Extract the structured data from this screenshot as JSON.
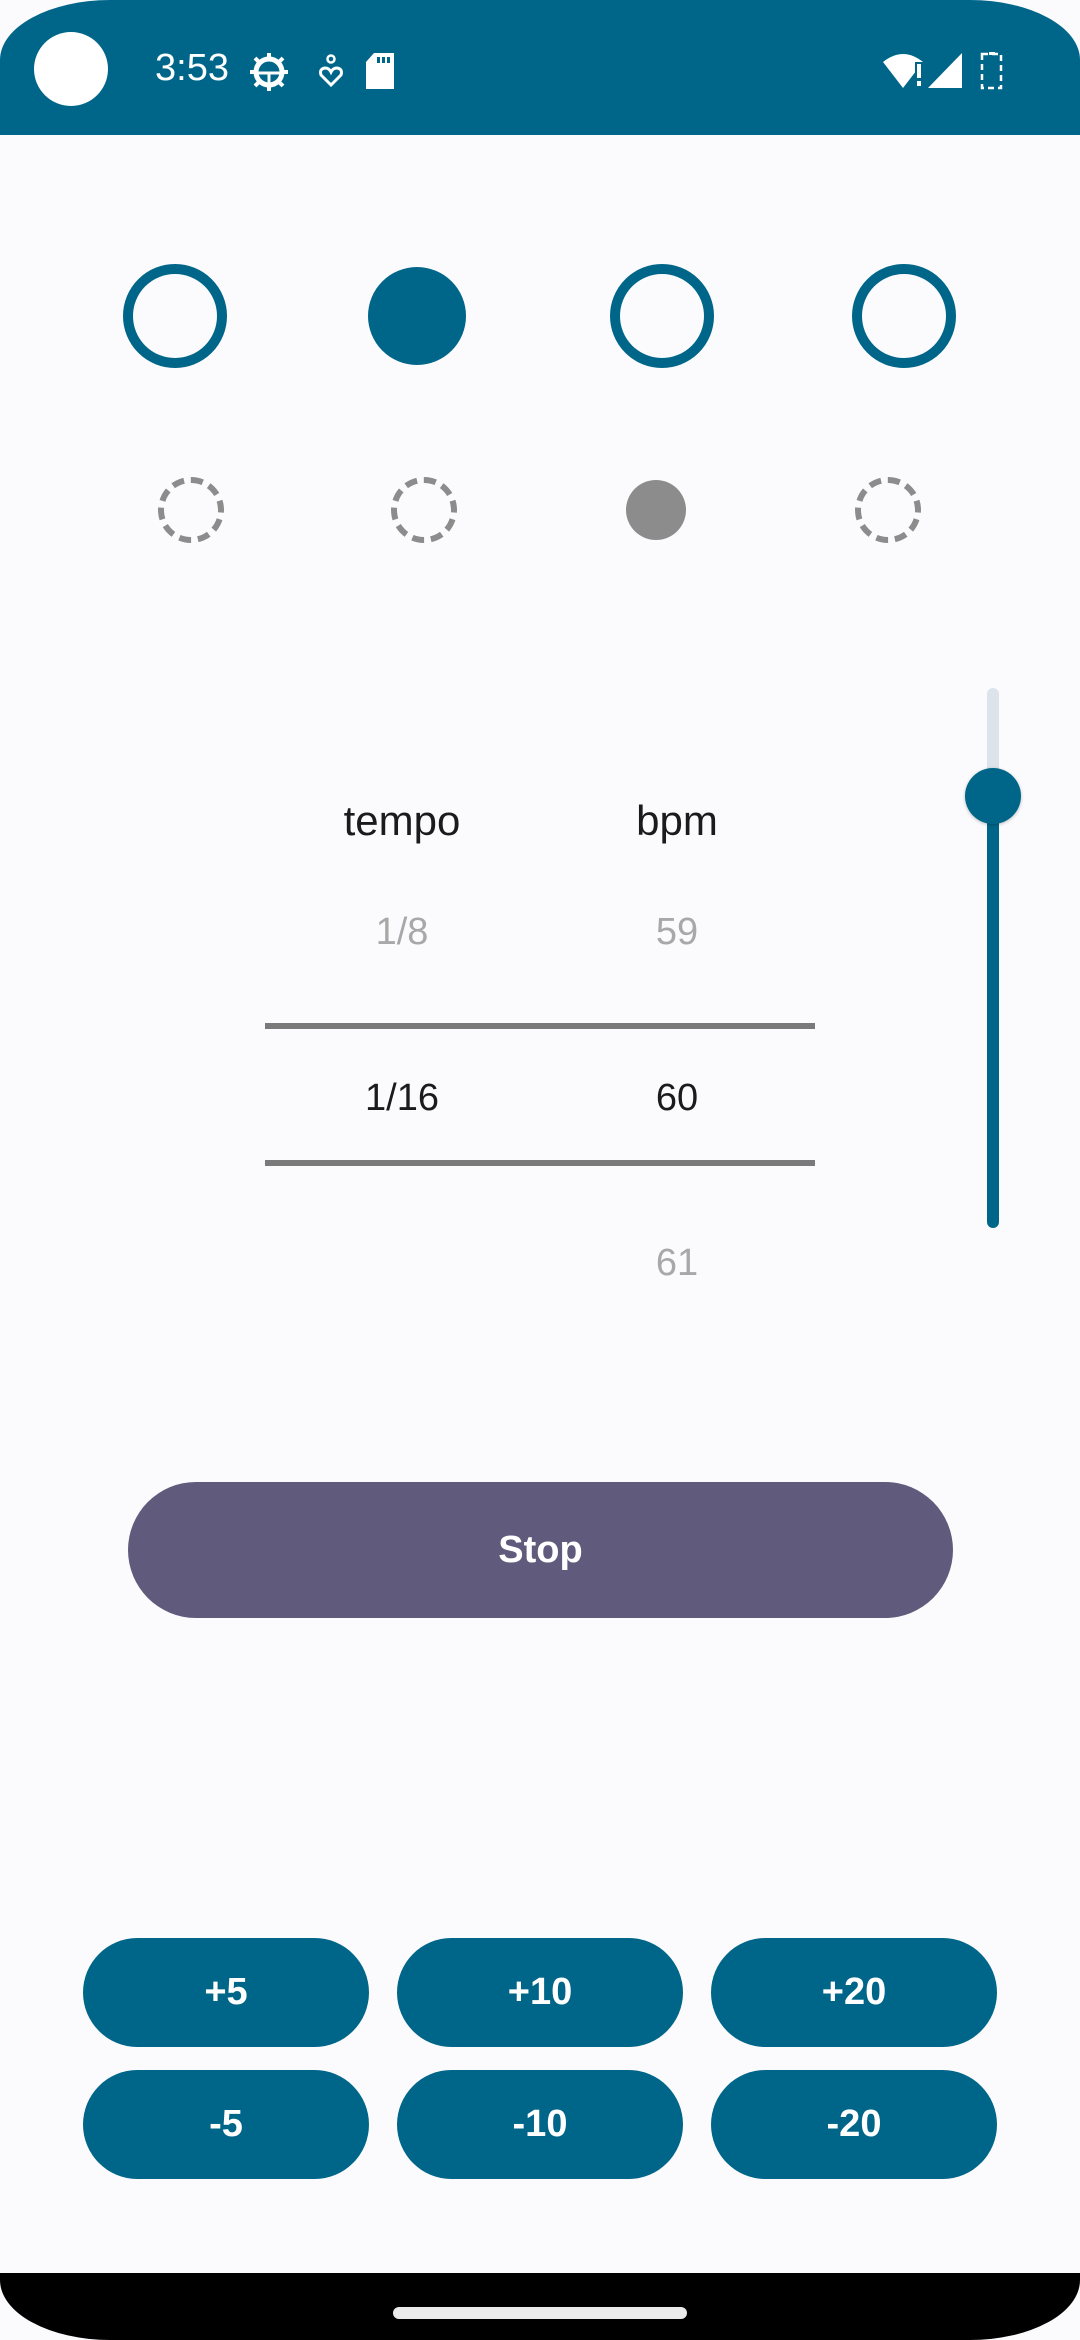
{
  "status_bar": {
    "time": "3:53",
    "icons_left": [
      "settings-gear-icon",
      "accessibility-heart-icon",
      "sd-card-icon"
    ],
    "icons_right": [
      "wifi-alert-icon",
      "cellular-signal-icon",
      "battery-icon"
    ]
  },
  "beats": {
    "main": [
      {
        "state": "outline"
      },
      {
        "state": "filled"
      },
      {
        "state": "outline"
      },
      {
        "state": "outline"
      }
    ],
    "sub": [
      {
        "state": "dashed"
      },
      {
        "state": "dashed"
      },
      {
        "state": "filled"
      },
      {
        "state": "dashed"
      }
    ]
  },
  "picker": {
    "tempo": {
      "header": "tempo",
      "previous": "1/8",
      "selected": "1/16",
      "next": ""
    },
    "bpm": {
      "header": "bpm",
      "previous": "59",
      "selected": "60",
      "next": "61"
    }
  },
  "volume_slider": {
    "value_fraction": 0.8
  },
  "controls": {
    "stop_label": "Stop",
    "increment_buttons": [
      "+5",
      "+10",
      "+20"
    ],
    "decrement_buttons": [
      "-5",
      "-10",
      "-20"
    ]
  },
  "colors": {
    "primary": "#006689",
    "stop_button": "#605a7c",
    "inactive_gray": "#8c8c8c",
    "background": "#fbfbfd"
  }
}
